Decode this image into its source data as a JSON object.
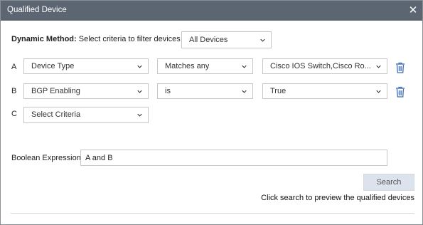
{
  "dialog": {
    "title": "Qualified Device",
    "close_glyph": "✕"
  },
  "method": {
    "label": "Dynamic Method:",
    "text": "Select criteria to filter devices in",
    "selected": "All Devices"
  },
  "rows": [
    {
      "letter": "A",
      "criteria": "Device Type",
      "operator": "Matches any",
      "value": "Cisco IOS Switch,Cisco Ro..."
    },
    {
      "letter": "B",
      "criteria": "BGP Enabling",
      "operator": "is",
      "value": "True"
    },
    {
      "letter": "C",
      "criteria": "Select Criteria"
    }
  ],
  "boolean": {
    "label": "Boolean Expression:",
    "value": "A and B"
  },
  "search": {
    "label": "Search",
    "hint": "Click search to preview the qualified devices"
  },
  "icons": {
    "close": "close-icon",
    "chevron": "chevron-down-icon",
    "trash": "trash-icon"
  },
  "colors": {
    "titlebar": "#5c6673",
    "trash": "#3f6fb3",
    "search_button": "#dde3ec"
  }
}
